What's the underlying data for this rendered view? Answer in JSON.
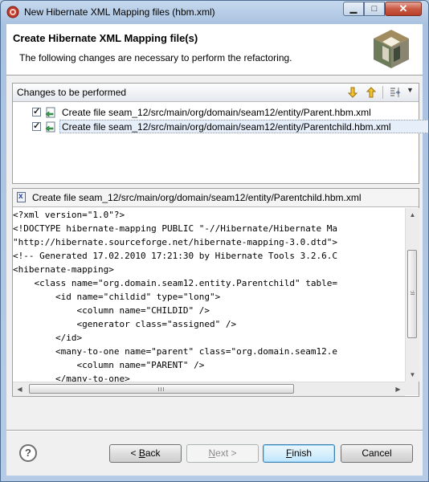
{
  "window": {
    "title": "New Hibernate XML Mapping files (hbm.xml)"
  },
  "banner": {
    "title": "Create Hibernate XML Mapping file(s)",
    "description": "The following changes are necessary to perform the refactoring."
  },
  "changes": {
    "label": "Changes to be performed",
    "items": [
      {
        "label": "Create file seam_12/src/main/org/domain/seam12/entity/Parent.hbm.xml",
        "checked": true
      },
      {
        "label": "Create file seam_12/src/main/org/domain/seam12/entity/Parentchild.hbm.xml",
        "checked": true
      }
    ]
  },
  "preview": {
    "label": "Create file seam_12/src/main/org/domain/seam12/entity/Parentchild.hbm.xml",
    "lines": [
      "<?xml version=\"1.0\"?>",
      "<!DOCTYPE hibernate-mapping PUBLIC \"-//Hibernate/Hibernate Ma",
      "\"http://hibernate.sourceforge.net/hibernate-mapping-3.0.dtd\">",
      "<!-- Generated 17.02.2010 17:21:30 by Hibernate Tools 3.2.6.C",
      "<hibernate-mapping>",
      "    <class name=\"org.domain.seam12.entity.Parentchild\" table=",
      "        <id name=\"childid\" type=\"long\">",
      "            <column name=\"CHILDID\" />",
      "            <generator class=\"assigned\" />",
      "        </id>",
      "        <many-to-one name=\"parent\" class=\"org.domain.seam12.e",
      "            <column name=\"PARENT\" />",
      "        </many-to-one>"
    ]
  },
  "buttons": {
    "back": {
      "prefix": "< ",
      "mnemonic": "B",
      "rest": "ack"
    },
    "next": {
      "mnemonic": "N",
      "rest": "ext >"
    },
    "finish": {
      "mnemonic": "F",
      "rest": "inish"
    },
    "cancel": "Cancel"
  },
  "colors": {
    "title_bar": "#c5d8ee",
    "close_button": "#c95a43",
    "selection": "#e6eef9",
    "default_button_border": "#3c7fb1"
  }
}
